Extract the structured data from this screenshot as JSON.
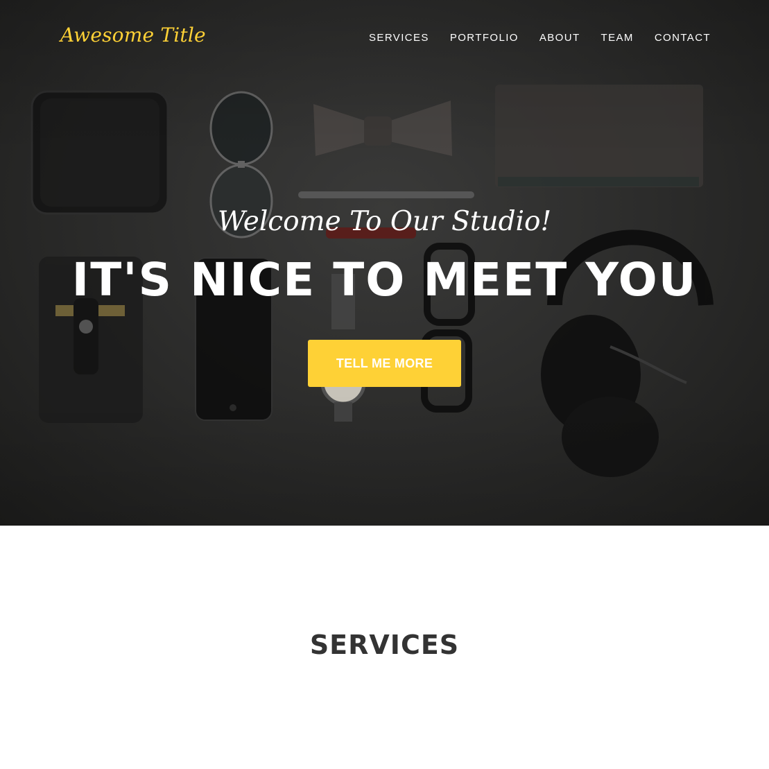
{
  "navbar": {
    "brand": "Awesome Title",
    "links": [
      "SERVICES",
      "PORTFOLIO",
      "ABOUT",
      "TEAM",
      "CONTACT"
    ]
  },
  "hero": {
    "lead_in": "Welcome To Our Studio!",
    "heading": "IT'S NICE TO MEET YOU",
    "button_label": "TELL ME MORE"
  },
  "services": {
    "heading": "SERVICES"
  },
  "colors": {
    "accent": "#fed136",
    "heading_dark": "#333333",
    "hero_background": "#2a2a29"
  }
}
